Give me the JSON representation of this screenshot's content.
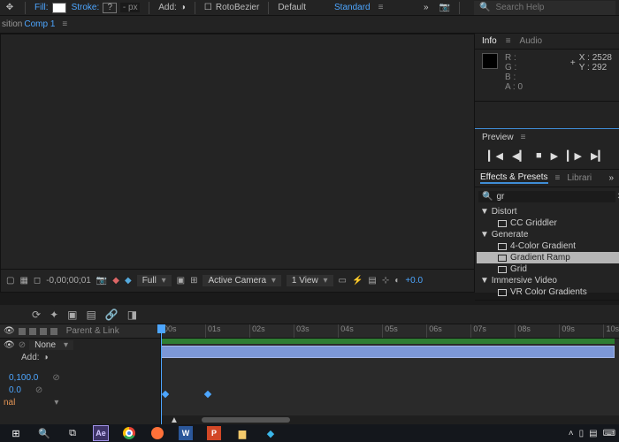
{
  "top": {
    "fill_label": "Fill:",
    "stroke_label": "Stroke:",
    "stroke_val": "?",
    "px_val": "- px",
    "add_label": "Add:",
    "rotobezier": "RotoBezier",
    "default": "Default",
    "standard": "Standard",
    "search_placeholder": "Search Help"
  },
  "second": {
    "prefix": "sition",
    "comp": "Comp 1"
  },
  "info_panel": {
    "tab_info": "Info",
    "tab_audio": "Audio",
    "R": "R :",
    "G": "G :",
    "B": "B :",
    "A": "A :   0",
    "X": "X : 2528",
    "Y": "Y :   292"
  },
  "preview": {
    "title": "Preview"
  },
  "effects": {
    "tab_effects": "Effects & Presets",
    "tab_libs": "Librari",
    "search": "gr",
    "cats": {
      "distort": "Distort",
      "distort_items": [
        "CC Griddler"
      ],
      "generate": "Generate",
      "generate_items": [
        "4-Color Gradient",
        "Gradient Ramp",
        "Grid"
      ],
      "immersive": "Immersive Video",
      "immersive_items": [
        "VR Color Gradients"
      ]
    }
  },
  "viewer_footer": {
    "timecode": "-0,00;00;01",
    "res": "Full",
    "camera": "Active Camera",
    "views": "1 View",
    "exposure": "+0.0"
  },
  "timeline": {
    "header_parent": "Parent & Link",
    "none": "None",
    "add": "Add:",
    "prop1": "0,100.0",
    "prop2": "0.0",
    "mode": "nal",
    "ticks": [
      "00s",
      "01s",
      "02s",
      "03s",
      "04s",
      "05s",
      "06s",
      "07s",
      "08s",
      "09s",
      "10s"
    ]
  },
  "taskbar": {
    "ae": "Ae",
    "word": "W",
    "ppt": "P"
  }
}
